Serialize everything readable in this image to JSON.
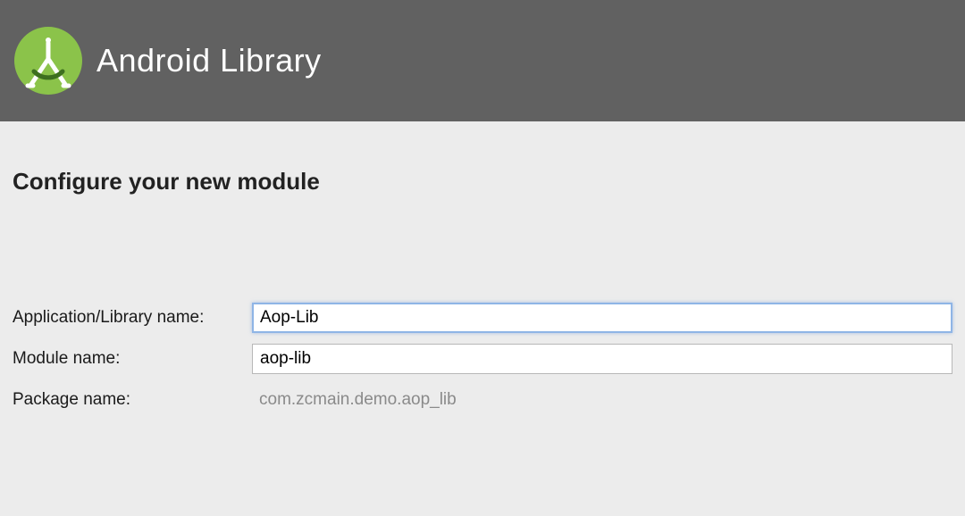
{
  "header": {
    "title": "Android Library"
  },
  "section": {
    "title": "Configure your new module"
  },
  "form": {
    "app_name_label": "Application/Library name:",
    "app_name_value": "Aop-Lib",
    "module_name_label": "Module name:",
    "module_name_value": "aop-lib",
    "package_name_label": "Package name:",
    "package_name_value": "com.zcmain.demo.aop_lib"
  }
}
